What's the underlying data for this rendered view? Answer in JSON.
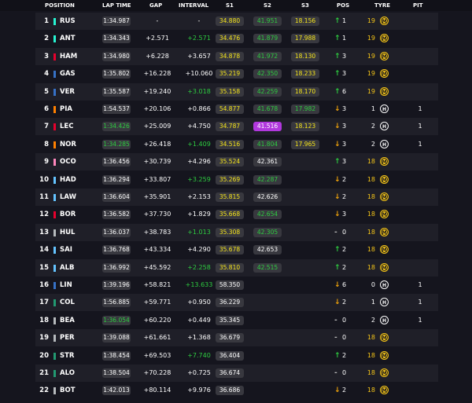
{
  "headers": {
    "position": "POSITION",
    "lap_time": "LAP TIME",
    "gap": "GAP",
    "interval": "INTERVAL",
    "s1": "S1",
    "s2": "S2",
    "s3": "S3",
    "pos": "POS",
    "tyre": "TYRE",
    "pit": "PIT"
  },
  "rows": [
    {
      "pos": "1",
      "color": "#27f4d2",
      "code": "RUS",
      "lap": "1:34.987",
      "lap_best": false,
      "gap": "-",
      "int": "-",
      "int_green": false,
      "s1": "34.880",
      "s1c": "yel",
      "s2": "41.951",
      "s2c": "grn",
      "s3": "18.156",
      "s3c": "yel",
      "arrow": "↑",
      "dir": "up",
      "pchg": "1",
      "tage": "19",
      "tyre": "M",
      "pit": ""
    },
    {
      "pos": "2",
      "color": "#27f4d2",
      "code": "ANT",
      "lap": "1:34.343",
      "lap_best": false,
      "gap": "+2.571",
      "int": "+2.571",
      "int_green": true,
      "s1": "34.476",
      "s1c": "yel",
      "s2": "41.879",
      "s2c": "grn",
      "s3": "17.988",
      "s3c": "yel",
      "arrow": "↑",
      "dir": "up",
      "pchg": "1",
      "tage": "19",
      "tyre": "M",
      "pit": ""
    },
    {
      "pos": "3",
      "color": "#e8002d",
      "code": "HAM",
      "lap": "1:34.980",
      "lap_best": false,
      "gap": "+6.228",
      "int": "+3.657",
      "int_green": false,
      "s1": "34.878",
      "s1c": "yel",
      "s2": "41.972",
      "s2c": "grn",
      "s3": "18.130",
      "s3c": "yel",
      "arrow": "↑",
      "dir": "up",
      "pchg": "3",
      "tage": "19",
      "tyre": "M",
      "pit": ""
    },
    {
      "pos": "4",
      "color": "#3671c6",
      "code": "GAS",
      "lap": "1:35.802",
      "lap_best": false,
      "gap": "+16.228",
      "int": "+10.060",
      "int_green": false,
      "s1": "35.219",
      "s1c": "yel",
      "s2": "42.350",
      "s2c": "grn",
      "s3": "18.233",
      "s3c": "yel",
      "arrow": "↑",
      "dir": "up",
      "pchg": "3",
      "tage": "19",
      "tyre": "M",
      "pit": ""
    },
    {
      "pos": "5",
      "color": "#3671c6",
      "code": "VER",
      "lap": "1:35.587",
      "lap_best": false,
      "gap": "+19.240",
      "int": "+3.018",
      "int_green": true,
      "s1": "35.158",
      "s1c": "yel",
      "s2": "42.259",
      "s2c": "grn",
      "s3": "18.170",
      "s3c": "yel",
      "arrow": "↑",
      "dir": "up",
      "pchg": "6",
      "tage": "19",
      "tyre": "M",
      "pit": ""
    },
    {
      "pos": "6",
      "color": "#ff8000",
      "code": "PIA",
      "lap": "1:54.537",
      "lap_best": false,
      "gap": "+20.106",
      "int": "+0.866",
      "int_green": false,
      "s1": "54.877",
      "s1c": "yel",
      "s2": "41.678",
      "s2c": "grn",
      "s3": "17.982",
      "s3c": "grn",
      "arrow": "↓",
      "dir": "down",
      "pchg": "3",
      "tage": "1",
      "tyre": "H",
      "pit": "1"
    },
    {
      "pos": "7",
      "color": "#e8002d",
      "code": "LEC",
      "lap": "1:34.426",
      "lap_best": true,
      "gap": "+25.009",
      "int": "+4.750",
      "int_green": false,
      "s1": "34.787",
      "s1c": "yel",
      "s2": "41.516",
      "s2c": "pur",
      "s3": "18.123",
      "s3c": "yel",
      "arrow": "↓",
      "dir": "down",
      "pchg": "3",
      "tage": "2",
      "tyre": "H",
      "pit": "1"
    },
    {
      "pos": "8",
      "color": "#ff8000",
      "code": "NOR",
      "lap": "1:34.285",
      "lap_best": true,
      "gap": "+26.418",
      "int": "+1.409",
      "int_green": true,
      "s1": "34.516",
      "s1c": "yel",
      "s2": "41.804",
      "s2c": "grn",
      "s3": "17.965",
      "s3c": "yel",
      "arrow": "↓",
      "dir": "down",
      "pchg": "3",
      "tage": "2",
      "tyre": "H",
      "pit": "1"
    },
    {
      "pos": "9",
      "color": "#ff87bc",
      "code": "OCO",
      "lap": "1:36.456",
      "lap_best": false,
      "gap": "+30.739",
      "int": "+4.296",
      "int_green": false,
      "s1": "35.524",
      "s1c": "yel",
      "s2": "42.361",
      "s2c": "wht",
      "s3": "",
      "s3c": "",
      "arrow": "↑",
      "dir": "up",
      "pchg": "3",
      "tage": "18",
      "tyre": "M",
      "pit": ""
    },
    {
      "pos": "10",
      "color": "#64c4ff",
      "code": "HAD",
      "lap": "1:36.294",
      "lap_best": false,
      "gap": "+33.807",
      "int": "+3.259",
      "int_green": true,
      "s1": "35.269",
      "s1c": "yel",
      "s2": "42.287",
      "s2c": "grn",
      "s3": "",
      "s3c": "",
      "arrow": "↓",
      "dir": "down",
      "pchg": "2",
      "tage": "18",
      "tyre": "M",
      "pit": ""
    },
    {
      "pos": "11",
      "color": "#64c4ff",
      "code": "LAW",
      "lap": "1:36.604",
      "lap_best": false,
      "gap": "+35.901",
      "int": "+2.153",
      "int_green": false,
      "s1": "35.815",
      "s1c": "yel",
      "s2": "42.626",
      "s2c": "wht",
      "s3": "",
      "s3c": "",
      "arrow": "↓",
      "dir": "down",
      "pchg": "2",
      "tage": "18",
      "tyre": "M",
      "pit": ""
    },
    {
      "pos": "12",
      "color": "#e8002d",
      "code": "BOR",
      "lap": "1:36.582",
      "lap_best": false,
      "gap": "+37.730",
      "int": "+1.829",
      "int_green": false,
      "s1": "35.668",
      "s1c": "yel",
      "s2": "42.654",
      "s2c": "grn",
      "s3": "",
      "s3c": "",
      "arrow": "↓",
      "dir": "down",
      "pchg": "3",
      "tage": "18",
      "tyre": "M",
      "pit": ""
    },
    {
      "pos": "13",
      "color": "#b6babd",
      "code": "HUL",
      "lap": "1:36.037",
      "lap_best": false,
      "gap": "+38.783",
      "int": "+1.013",
      "int_green": true,
      "s1": "35.308",
      "s1c": "yel",
      "s2": "42.305",
      "s2c": "grn",
      "s3": "",
      "s3c": "",
      "arrow": "-",
      "dir": "flat",
      "pchg": "0",
      "tage": "18",
      "tyre": "M",
      "pit": ""
    },
    {
      "pos": "14",
      "color": "#64c4ff",
      "code": "SAI",
      "lap": "1:36.768",
      "lap_best": false,
      "gap": "+43.334",
      "int": "+4.290",
      "int_green": false,
      "s1": "35.678",
      "s1c": "yel",
      "s2": "42.653",
      "s2c": "wht",
      "s3": "",
      "s3c": "",
      "arrow": "↑",
      "dir": "up",
      "pchg": "2",
      "tage": "18",
      "tyre": "M",
      "pit": ""
    },
    {
      "pos": "15",
      "color": "#64c4ff",
      "code": "ALB",
      "lap": "1:36.992",
      "lap_best": false,
      "gap": "+45.592",
      "int": "+2.258",
      "int_green": true,
      "s1": "35.810",
      "s1c": "yel",
      "s2": "42.515",
      "s2c": "grn",
      "s3": "",
      "s3c": "",
      "arrow": "↑",
      "dir": "up",
      "pchg": "2",
      "tage": "18",
      "tyre": "M",
      "pit": ""
    },
    {
      "pos": "16",
      "color": "#3671c6",
      "code": "LIN",
      "lap": "1:39.196",
      "lap_best": false,
      "gap": "+58.821",
      "int": "+13.633",
      "int_green": true,
      "s1": "58.350",
      "s1c": "wht",
      "s2": "",
      "s2c": "",
      "s3": "",
      "s3c": "",
      "arrow": "↓",
      "dir": "down",
      "pchg": "6",
      "tage": "0",
      "tyre": "H",
      "pit": "1"
    },
    {
      "pos": "17",
      "color": "#229971",
      "code": "COL",
      "lap": "1:56.885",
      "lap_best": false,
      "gap": "+59.771",
      "int": "+0.950",
      "int_green": false,
      "s1": "36.229",
      "s1c": "wht",
      "s2": "",
      "s2c": "",
      "s3": "",
      "s3c": "",
      "arrow": "↓",
      "dir": "down",
      "pchg": "2",
      "tage": "1",
      "tyre": "H",
      "pit": "1"
    },
    {
      "pos": "18",
      "color": "#b6babd",
      "code": "BEA",
      "lap": "1:36.054",
      "lap_best": true,
      "gap": "+60.220",
      "int": "+0.449",
      "int_green": false,
      "s1": "35.345",
      "s1c": "wht",
      "s2": "",
      "s2c": "",
      "s3": "",
      "s3c": "",
      "arrow": "-",
      "dir": "flat",
      "pchg": "0",
      "tage": "2",
      "tyre": "H",
      "pit": "1"
    },
    {
      "pos": "19",
      "color": "#b6babd",
      "code": "PER",
      "lap": "1:39.088",
      "lap_best": false,
      "gap": "+61.661",
      "int": "+1.368",
      "int_green": false,
      "s1": "36.679",
      "s1c": "wht",
      "s2": "",
      "s2c": "",
      "s3": "",
      "s3c": "",
      "arrow": "-",
      "dir": "flat",
      "pchg": "0",
      "tage": "18",
      "tyre": "M",
      "pit": ""
    },
    {
      "pos": "20",
      "color": "#229971",
      "code": "STR",
      "lap": "1:38.454",
      "lap_best": false,
      "gap": "+69.503",
      "int": "+7.740",
      "int_green": true,
      "s1": "36.404",
      "s1c": "wht",
      "s2": "",
      "s2c": "",
      "s3": "",
      "s3c": "",
      "arrow": "↑",
      "dir": "up",
      "pchg": "2",
      "tage": "18",
      "tyre": "M",
      "pit": ""
    },
    {
      "pos": "21",
      "color": "#229971",
      "code": "ALO",
      "lap": "1:38.504",
      "lap_best": false,
      "gap": "+70.228",
      "int": "+0.725",
      "int_green": false,
      "s1": "36.674",
      "s1c": "wht",
      "s2": "",
      "s2c": "",
      "s3": "",
      "s3c": "",
      "arrow": "-",
      "dir": "flat",
      "pchg": "0",
      "tage": "18",
      "tyre": "M",
      "pit": ""
    },
    {
      "pos": "22",
      "color": "#b6babd",
      "code": "BOT",
      "lap": "1:42.013",
      "lap_best": false,
      "gap": "+80.114",
      "int": "+9.976",
      "int_green": false,
      "s1": "36.686",
      "s1c": "wht",
      "s2": "",
      "s2c": "",
      "s3": "",
      "s3c": "",
      "arrow": "↓",
      "dir": "down",
      "pchg": "2",
      "tage": "18",
      "tyre": "M",
      "pit": ""
    }
  ]
}
